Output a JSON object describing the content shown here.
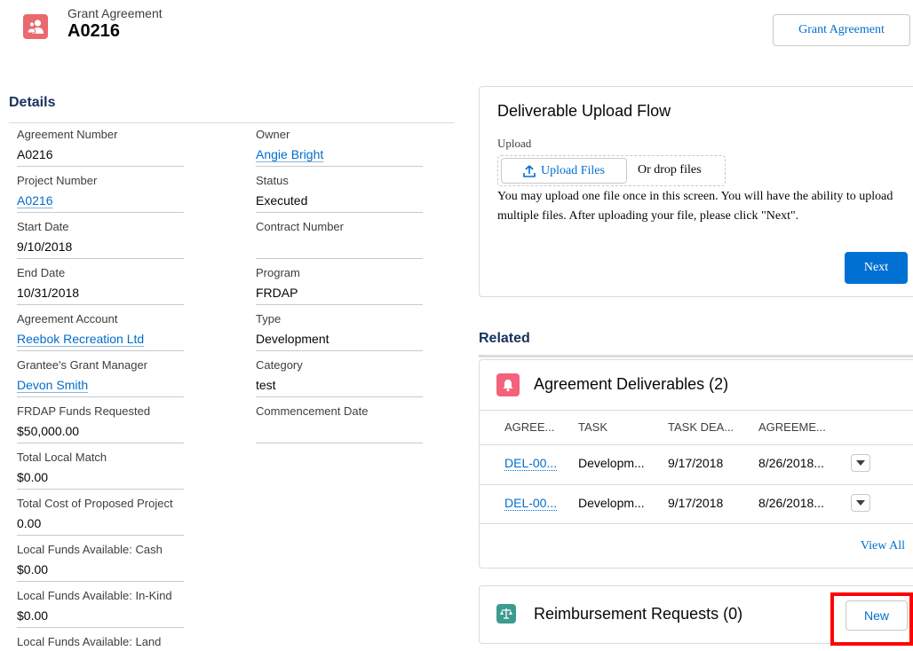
{
  "header": {
    "record_type": "Grant Agreement",
    "record_name": "A0216",
    "action_button": "Grant Agreement",
    "icon": "grant-people-icon",
    "icon_color": "#e9696e"
  },
  "details": {
    "title": "Details",
    "left_fields": [
      {
        "label": "Agreement Number",
        "value": "A0216"
      },
      {
        "label": "Project Number",
        "value": "A0216"
      },
      {
        "label": "Start Date",
        "value": "9/10/2018"
      },
      {
        "label": "End Date",
        "value": "10/31/2018"
      },
      {
        "label": "Agreement Account",
        "value": "Reebok Recreation Ltd"
      },
      {
        "label": "Grantee's Grant Manager",
        "value": "Devon Smith"
      },
      {
        "label": "FRDAP Funds Requested",
        "value": "$50,000.00"
      },
      {
        "label": "Total Local Match",
        "value": "$0.00"
      },
      {
        "label": "Total Cost of Proposed Project",
        "value": "0.00"
      },
      {
        "label": "Local Funds Available: Cash",
        "value": "$0.00"
      },
      {
        "label": "Local Funds Available: In-Kind",
        "value": "$0.00"
      },
      {
        "label": "Local Funds Available: Land",
        "value": ""
      }
    ],
    "right_fields": [
      {
        "label": "Owner",
        "value": "Angie Bright"
      },
      {
        "label": "Status",
        "value": "Executed"
      },
      {
        "label": "Contract Number",
        "value": ""
      },
      {
        "label": "Program",
        "value": "FRDAP"
      },
      {
        "label": "Type",
        "value": "Development"
      },
      {
        "label": "Category",
        "value": "test"
      },
      {
        "label": "Commencement Date",
        "value": ""
      }
    ]
  },
  "flow": {
    "title": "Deliverable Upload Flow",
    "upload_label": "Upload",
    "upload_button": "Upload Files",
    "drop_text": "Or drop files",
    "description": "You may upload one file once in this screen. You will have the ability to upload multiple files. After uploading your file, please click \"Next\".",
    "next_button": "Next",
    "accent": "#0070d2"
  },
  "related": {
    "title": "Related",
    "deliverables": {
      "title": "Agreement Deliverables (2)",
      "icon": "bell-icon",
      "icon_color": "#f4627b",
      "columns": [
        "AGREE...",
        "TASK",
        "TASK DEA...",
        "AGREEME..."
      ],
      "rows": [
        [
          "DEL-00...",
          "Developm...",
          "9/17/2018",
          "8/26/2018..."
        ],
        [
          "DEL-00...",
          "Developm...",
          "9/17/2018",
          "8/26/2018..."
        ]
      ],
      "view_all": "View All"
    },
    "reimbursements": {
      "title": "Reimbursement Requests (0)",
      "icon": "scales-icon",
      "icon_color": "#3c9b8f",
      "new_button": "New"
    }
  }
}
